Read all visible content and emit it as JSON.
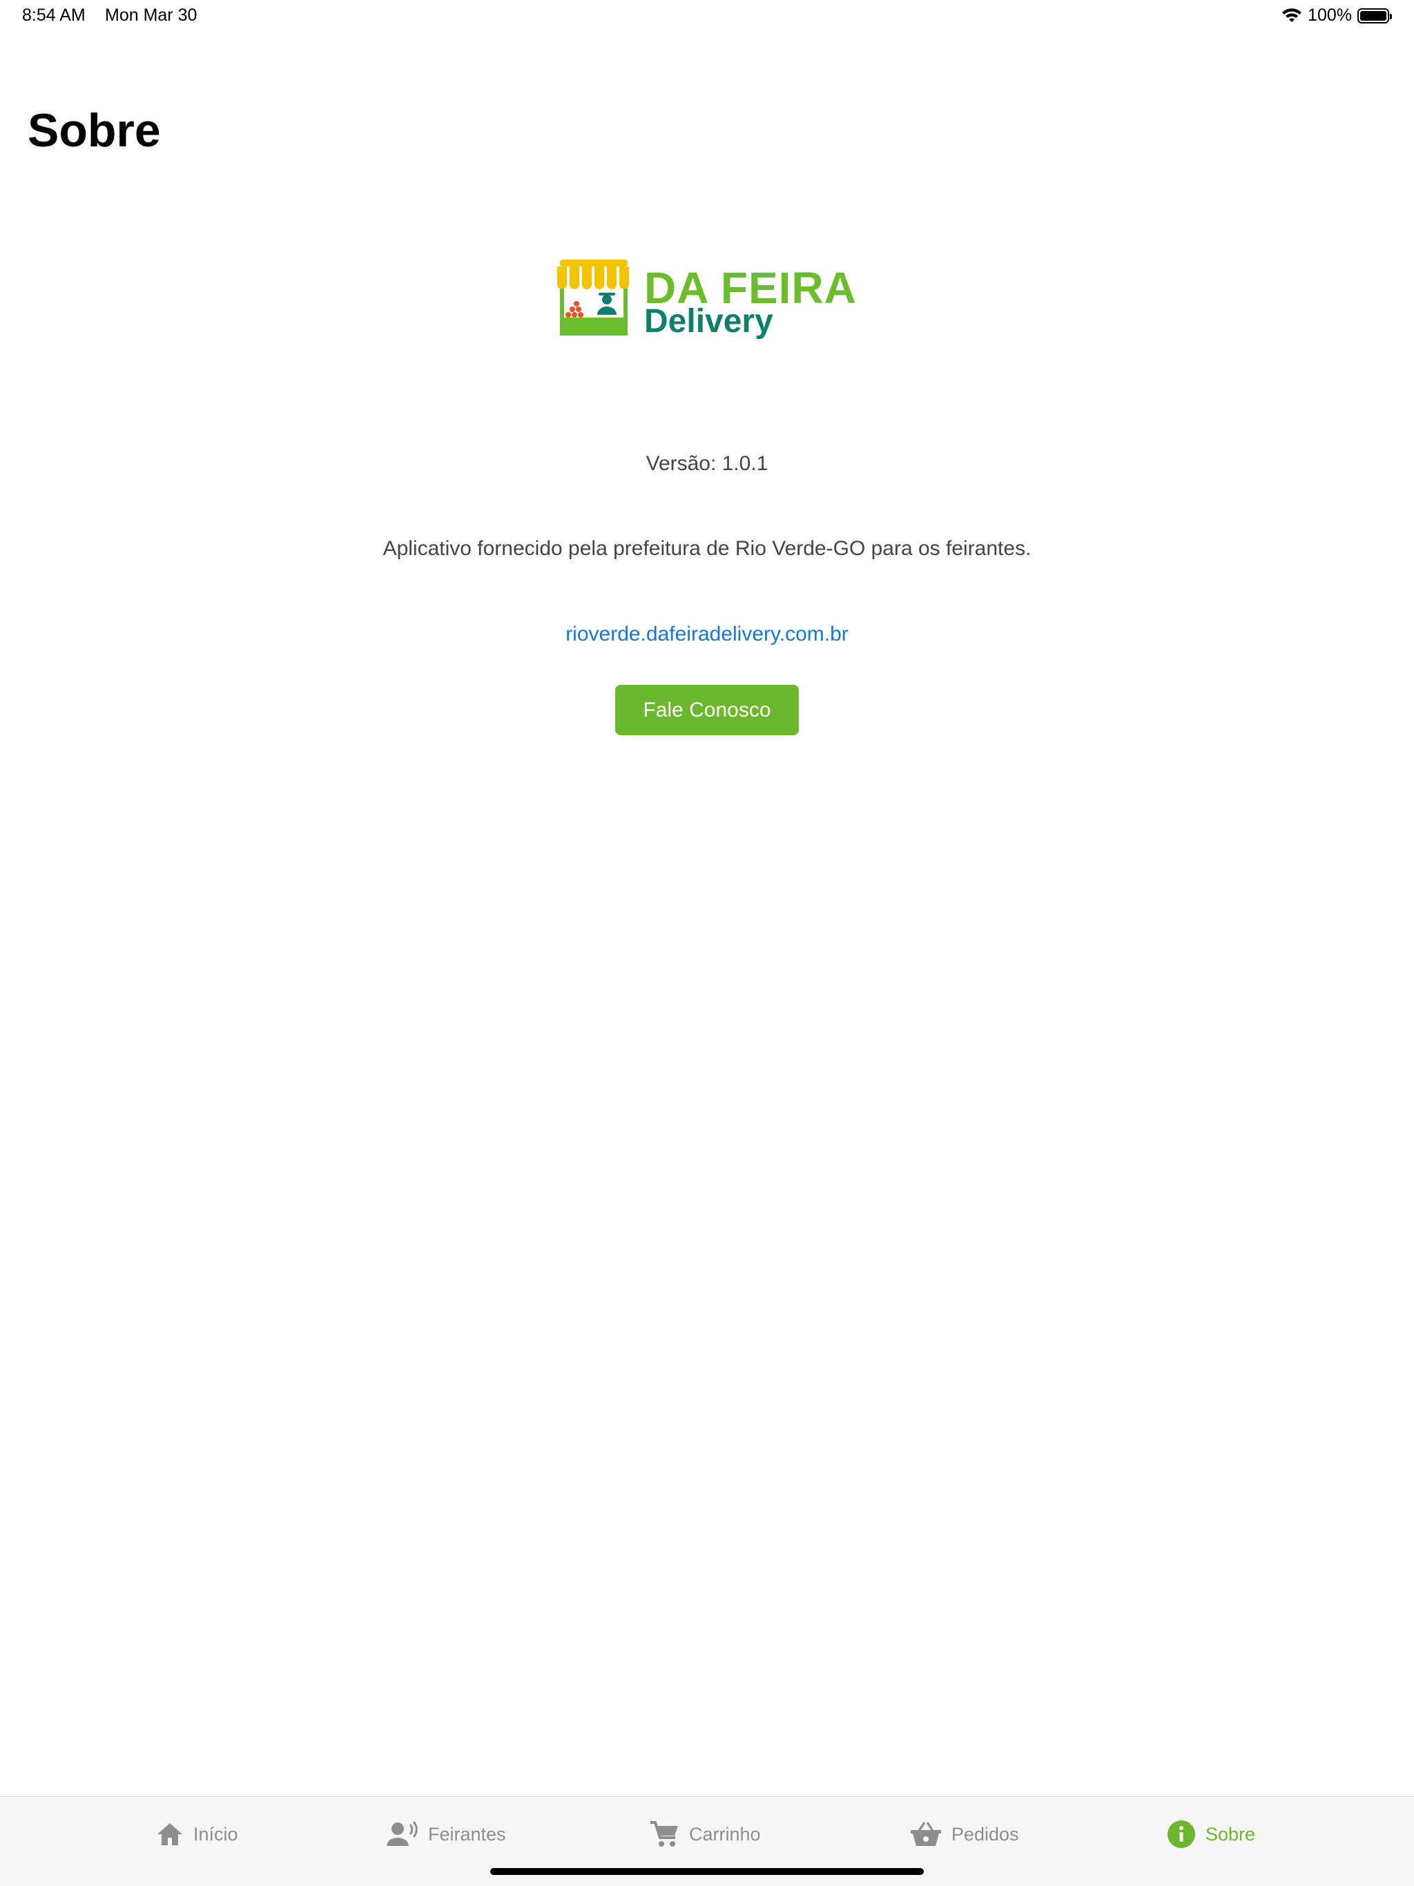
{
  "status_bar": {
    "time": "8:54 AM",
    "date": "Mon Mar 30",
    "battery": "100%"
  },
  "page": {
    "title": "Sobre"
  },
  "logo": {
    "line1": "DA FEIRA",
    "line2": "Delivery",
    "colors": {
      "green": "#6cbd2d",
      "teal": "#0d7f6b",
      "awning": "#f5c400"
    }
  },
  "content": {
    "version": "Versão: 1.0.1",
    "description": "Aplicativo fornecido pela prefeitura de Rio Verde-GO para os feirantes.",
    "link": "rioverde.dafeiradelivery.com.br",
    "contact_button": "Fale Conosco"
  },
  "tab_bar": {
    "items": [
      {
        "label": "Início",
        "icon": "home-icon",
        "active": false
      },
      {
        "label": "Feirantes",
        "icon": "person-voice-icon",
        "active": false
      },
      {
        "label": "Carrinho",
        "icon": "cart-icon",
        "active": false
      },
      {
        "label": "Pedidos",
        "icon": "basket-icon",
        "active": false
      },
      {
        "label": "Sobre",
        "icon": "info-icon",
        "active": true
      }
    ],
    "active_color": "#6bb82e",
    "inactive_color": "#8e8e8e"
  }
}
